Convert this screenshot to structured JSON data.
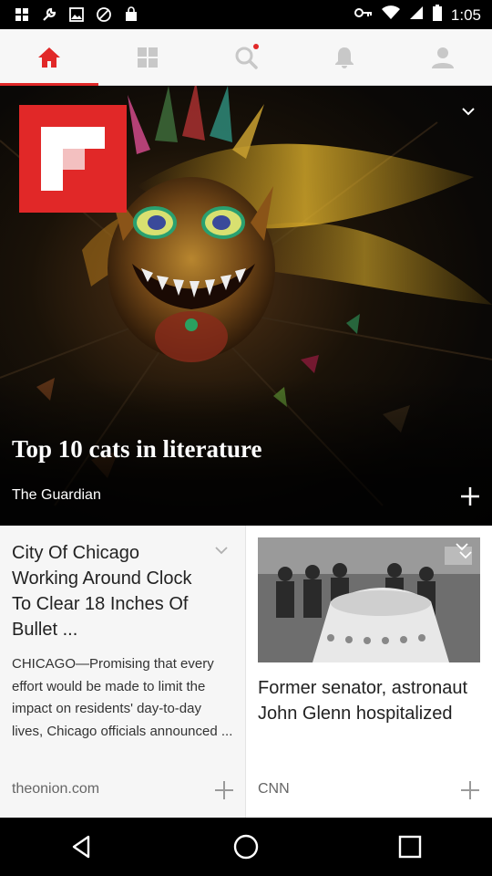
{
  "status_bar": {
    "time": "1:05",
    "icons": [
      "grid-icon",
      "wrench-icon",
      "photo-icon",
      "blocked-icon",
      "shopping-bag-icon",
      "key-icon",
      "wifi-icon",
      "signal-icon",
      "battery-icon"
    ]
  },
  "tabs": [
    {
      "name": "home",
      "icon": "home-icon",
      "active": true
    },
    {
      "name": "grid",
      "icon": "grid-icon",
      "active": false
    },
    {
      "name": "search",
      "icon": "search-icon",
      "active": false,
      "has_dot": true
    },
    {
      "name": "notifications",
      "icon": "bell-icon",
      "active": false
    },
    {
      "name": "profile",
      "icon": "person-icon",
      "active": false
    }
  ],
  "colors": {
    "accent": "#e12828",
    "tab_icon_inactive": "#c8c8c8"
  },
  "hero": {
    "title": "Top 10 cats in literature",
    "source": "The Guardian"
  },
  "cards": [
    {
      "title": "City Of Chicago Working Around Clock To Clear 18 Inches Of Bullet ...",
      "body": "CHICAGO—Promising that every effort would be made to limit the impact on residents' day-to-day lives, Chicago officials announced ...",
      "source": "theonion.com"
    },
    {
      "title": "Former senator, astronaut John Glenn hospitalized",
      "source": "CNN"
    }
  ],
  "nav": [
    "back-icon",
    "home-icon",
    "recents-icon"
  ]
}
